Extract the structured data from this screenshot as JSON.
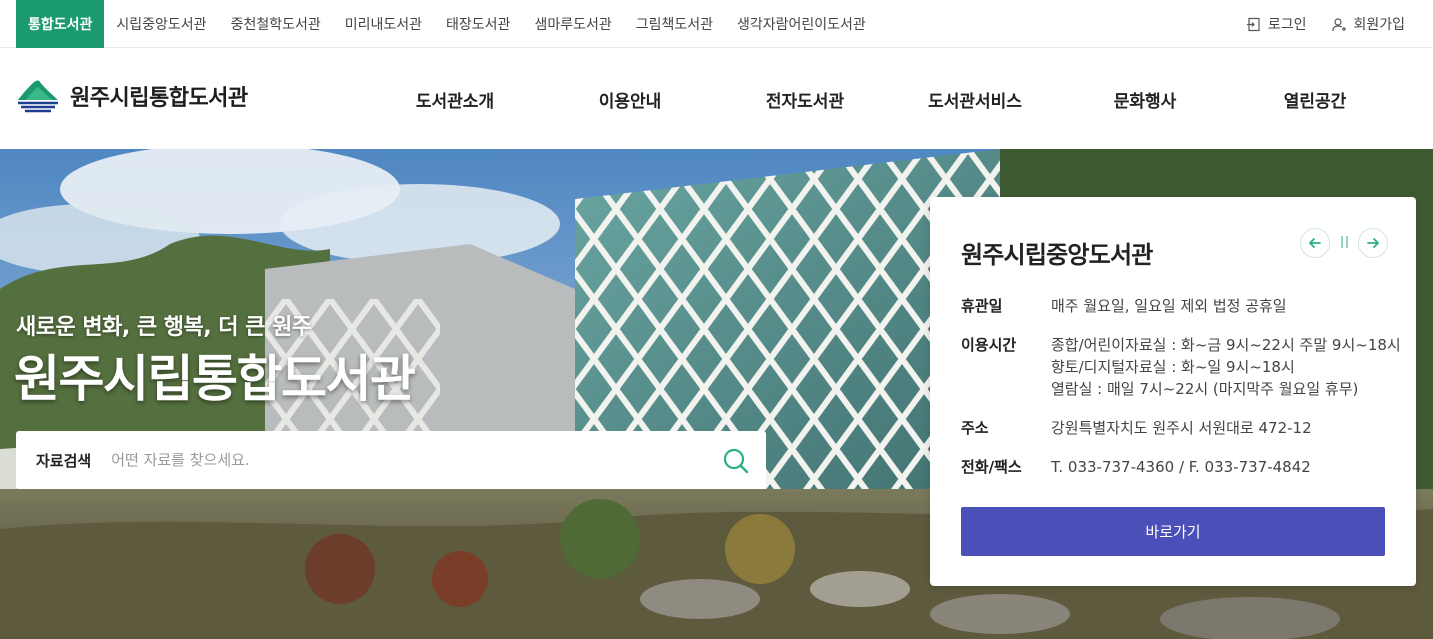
{
  "top_nav": {
    "libraries": [
      {
        "label": "통합도서관",
        "active": true
      },
      {
        "label": "시립중앙도서관",
        "active": false
      },
      {
        "label": "중천철학도서관",
        "active": false
      },
      {
        "label": "미리내도서관",
        "active": false
      },
      {
        "label": "태장도서관",
        "active": false
      },
      {
        "label": "샘마루도서관",
        "active": false
      },
      {
        "label": "그림책도서관",
        "active": false
      },
      {
        "label": "생각자람어린이도서관",
        "active": false
      }
    ],
    "login_label": "로그인",
    "signup_label": "회원가입",
    "active_color": "#1a9a6e"
  },
  "header": {
    "logo_text": "원주시립통합도서관",
    "menu": [
      "도서관소개",
      "이용안내",
      "전자도서관",
      "도서관서비스",
      "문화행사",
      "열린공간"
    ]
  },
  "hero": {
    "subtitle": "새로운 변화, 큰 행복, 더 큰 원주",
    "title": "원주시립통합도서관"
  },
  "search": {
    "label": "자료검색",
    "placeholder": "어떤 자료를 찾으세요.",
    "value": "",
    "icon": "search-icon"
  },
  "library_card": {
    "title": "원주시립중앙도서관",
    "rows": [
      {
        "label": "휴관일",
        "lines": [
          "매주 월요일, 일요일 제외 법정 공휴일"
        ]
      },
      {
        "label": "이용시간",
        "lines": [
          "종합/어린이자료실 : 화~금 9시~22시 주말 9시~18시",
          "향토/디지털자료실 : 화~일 9시~18시",
          "열람실 : 매일 7시~22시 (마지막주 월요일 휴무)"
        ]
      },
      {
        "label": "주소",
        "lines": [
          "강원특별자치도 원주시 서원대로 472-12"
        ]
      },
      {
        "label": "전화/팩스",
        "lines": [
          "T. 033-737-4360 / F. 033-737-4842"
        ]
      }
    ],
    "button_label": "바로가기",
    "button_color": "#4a50b8",
    "controls": [
      "prev-icon",
      "pause-icon",
      "next-icon"
    ]
  }
}
